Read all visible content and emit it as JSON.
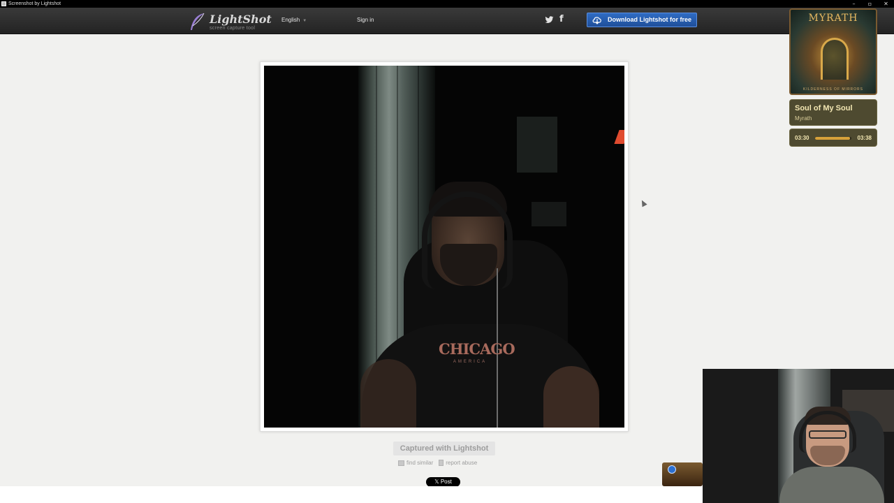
{
  "window": {
    "title": "Screenshot by Lightshot"
  },
  "header": {
    "brand": "LightShot",
    "tagline": "screen capture tool",
    "language": "English",
    "signin_label": "Sign in",
    "download_label": "Download Lightshot for free",
    "accent_color": "#2f6cc4"
  },
  "screenshot": {
    "shirt_text": "CHICAGO",
    "shirt_subtext": "AMERICA"
  },
  "footer": {
    "captured_label": "Captured with Lightshot",
    "find_similar_label": "find similar",
    "report_abuse_label": "report abuse",
    "post_label": "𝕏 Post"
  },
  "music": {
    "album_title": "MYRATH",
    "album_subtitle": "KILDERNESS OF MIRRORS",
    "track_title": "Soul of My Soul",
    "artist": "Myrath",
    "current_time": "03:30",
    "total_time": "03:38",
    "progress": 0.96
  },
  "icons": {
    "logo": "feather-icon",
    "twitter": "twitter-icon",
    "facebook": "facebook-icon",
    "download": "cloud-download-icon",
    "find_similar": "image-icon",
    "report_abuse": "document-icon"
  }
}
